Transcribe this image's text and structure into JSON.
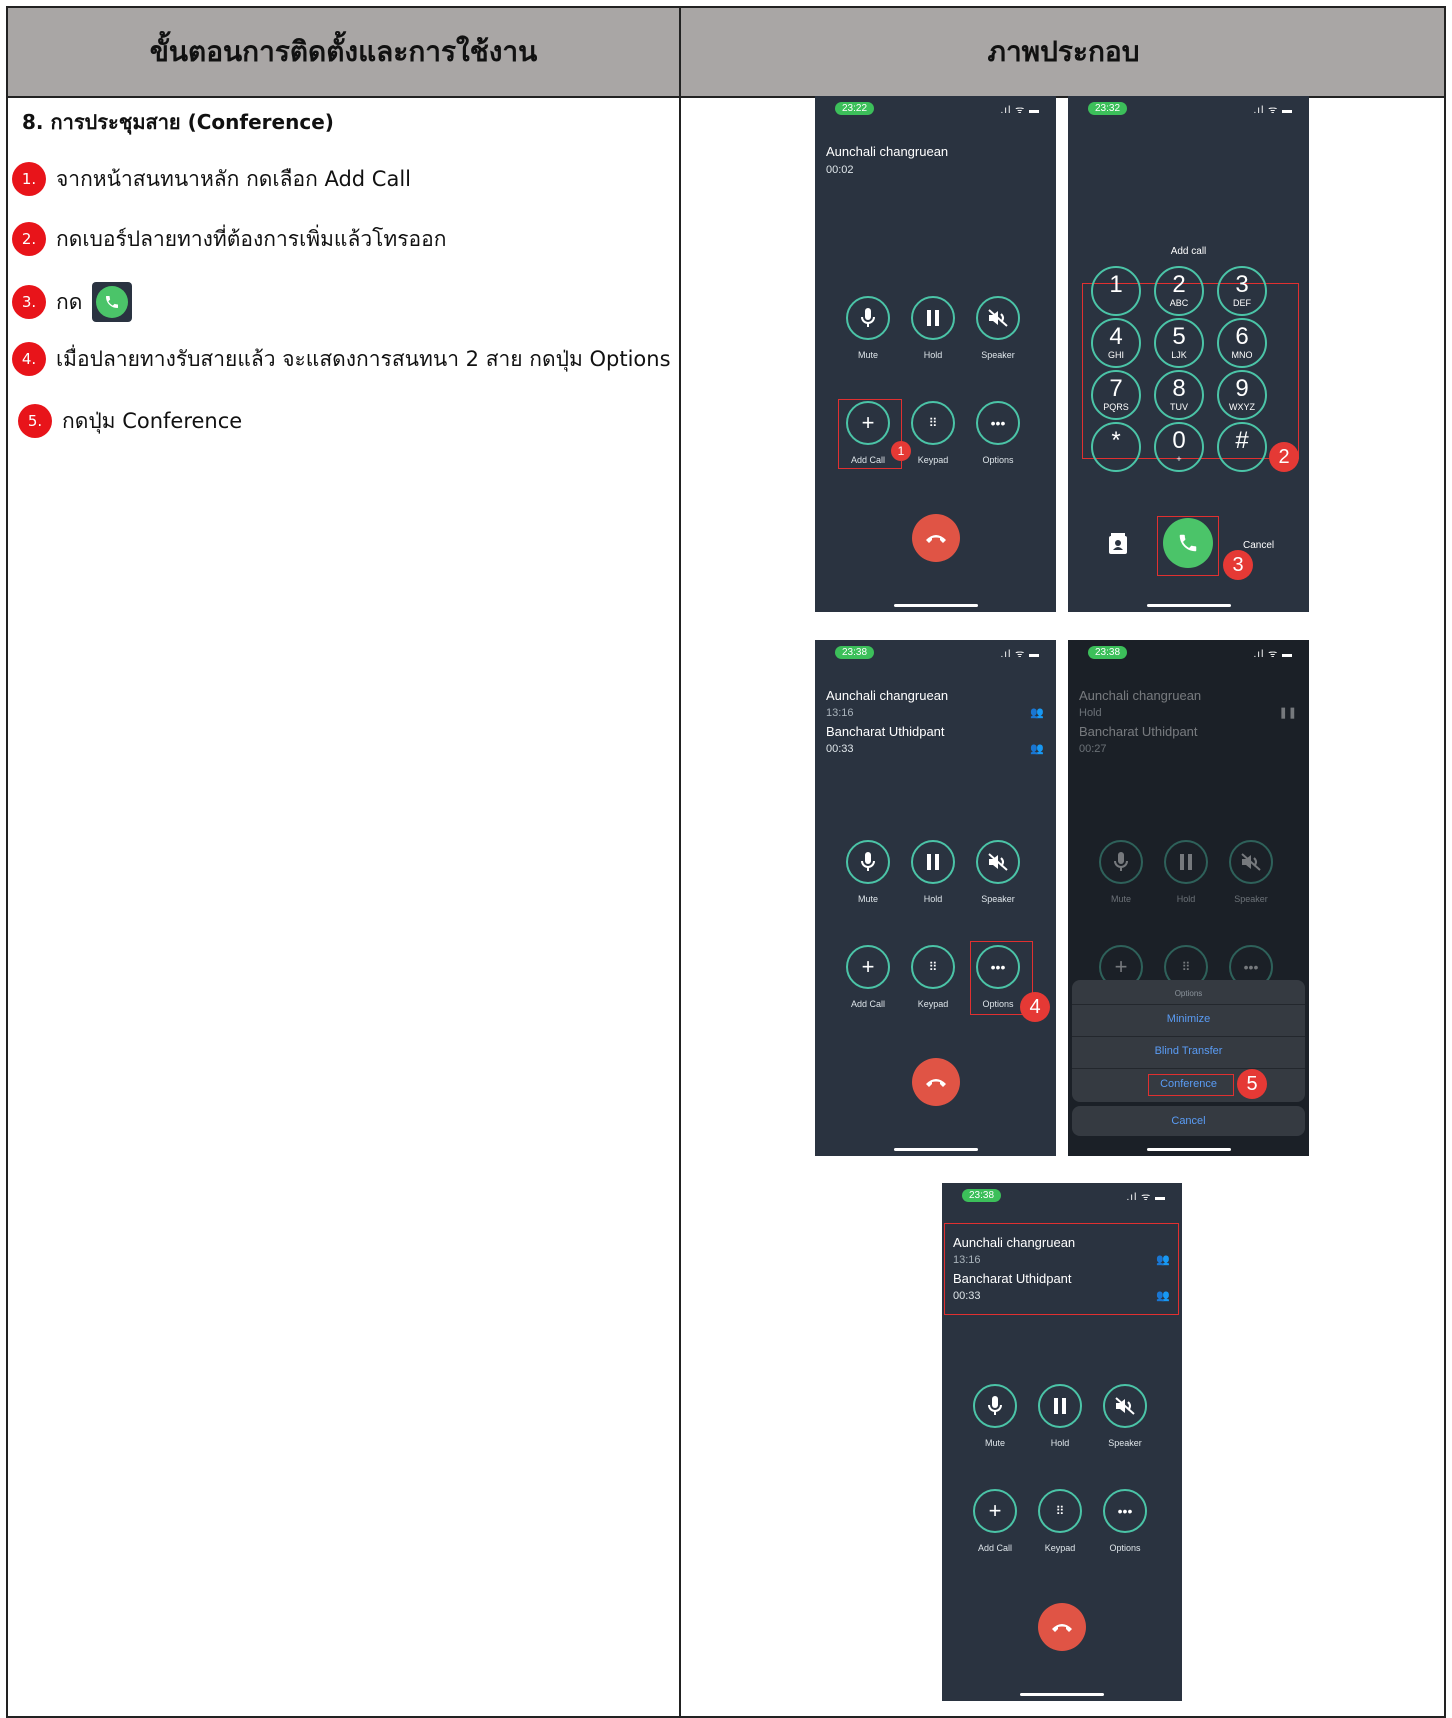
{
  "header": {
    "left": "ขั้นตอนการติดตั้งและการใช้งาน",
    "right": "ภาพประกอบ"
  },
  "section_title": "8. การประชุมสาย (Conference)",
  "steps": [
    {
      "num": "1.",
      "text": "จากหน้าสนทนาหลัก กดเลือก Add Call"
    },
    {
      "num": "2.",
      "text": "กดเบอร์ปลายทางที่ต้องการเพิ่มแล้วโทรออก"
    },
    {
      "num": "3.",
      "text": "กด"
    },
    {
      "num": "4.",
      "text": "เมื่อปลายทางรับสายแล้ว จะแสดงการสนทนา 2 สาย กดปุ่ม Options"
    },
    {
      "num": "5.",
      "text": "กดปุ่ม Conference"
    }
  ],
  "screens": {
    "s1": {
      "time": "23:22",
      "caller": "Aunchali changruean",
      "duration": "00:02"
    },
    "s2": {
      "time": "23:32",
      "title": "Add call",
      "cancel": "Cancel",
      "keys": [
        {
          "d": "1",
          "l": ""
        },
        {
          "d": "2",
          "l": "ABC"
        },
        {
          "d": "3",
          "l": "DEF"
        },
        {
          "d": "4",
          "l": "GHI"
        },
        {
          "d": "5",
          "l": "LJK"
        },
        {
          "d": "6",
          "l": "MNO"
        },
        {
          "d": "7",
          "l": "PQRS"
        },
        {
          "d": "8",
          "l": "TUV"
        },
        {
          "d": "9",
          "l": "WXYZ"
        },
        {
          "d": "*",
          "l": ""
        },
        {
          "d": "0",
          "l": "+"
        },
        {
          "d": "#",
          "l": ""
        }
      ]
    },
    "s3": {
      "time": "23:38",
      "caller1": "Aunchali changruean",
      "dur1": "13:16",
      "caller2": "Bancharat Uthidpant",
      "dur2": "00:33"
    },
    "s4": {
      "time": "23:38",
      "caller1": "Aunchali changruean",
      "status1": "Hold",
      "caller2": "Bancharat Uthidpant",
      "dur2": "00:27",
      "menu_title": "Options",
      "minimize": "Minimize",
      "blind": "Blind Transfer",
      "conference": "Conference",
      "cancel": "Cancel"
    },
    "s5": {
      "time": "23:38",
      "caller1": "Aunchali changruean",
      "dur1": "13:16",
      "caller2": "Bancharat Uthidpant",
      "dur2": "00:33"
    }
  },
  "controls": {
    "mute": "Mute",
    "hold": "Hold",
    "speaker": "Speaker",
    "add_call": "Add Call",
    "keypad": "Keypad",
    "options": "Options"
  },
  "badges": [
    "1",
    "2",
    "3",
    "4",
    "5"
  ]
}
